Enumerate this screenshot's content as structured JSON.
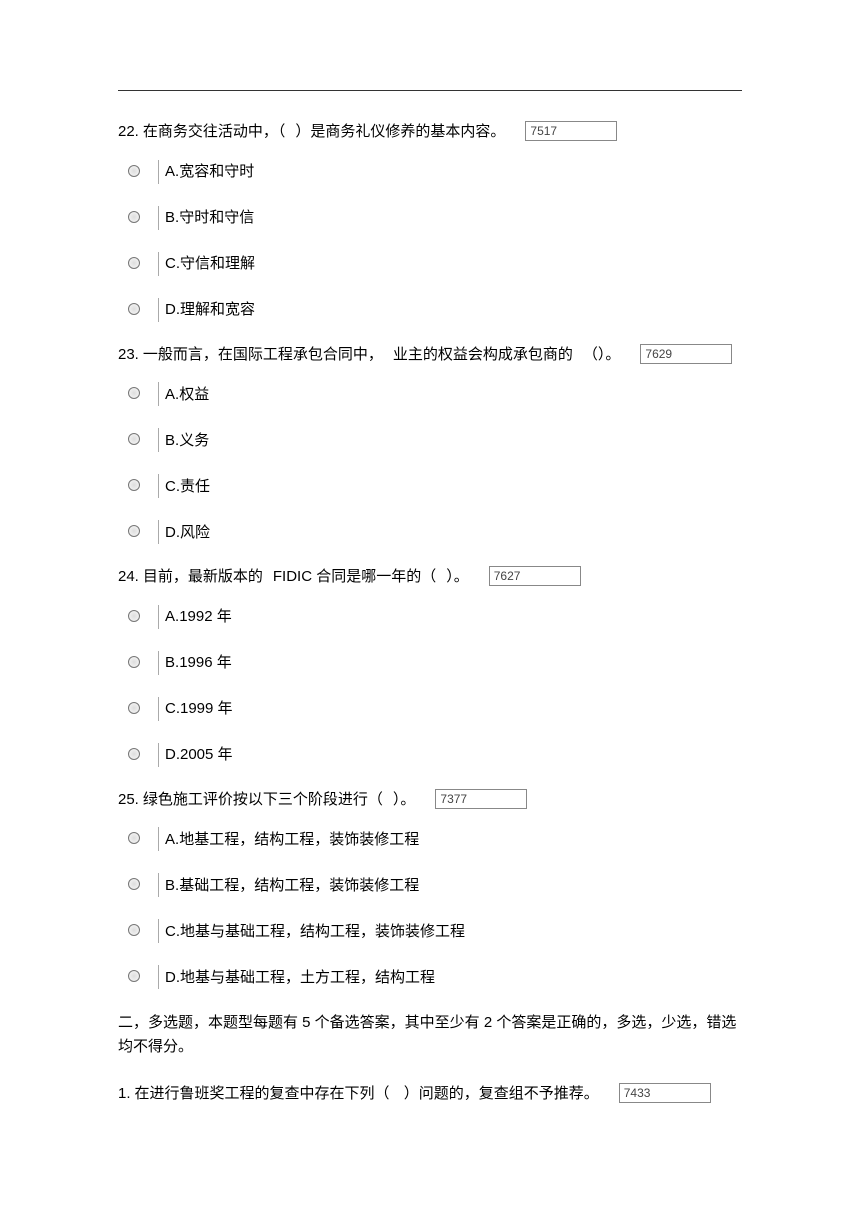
{
  "questions": [
    {
      "num": "22.",
      "parts": [
        "在商务交往活动中，（",
        "）是商务礼仪修养的基本内容。"
      ],
      "code": "7517",
      "options": [
        {
          "label": "A.",
          "text": "宽容和守时"
        },
        {
          "label": "B.",
          "text": "守时和守信"
        },
        {
          "label": "C.",
          "text": "守信和理解"
        },
        {
          "label": "D.",
          "text": "理解和宽容"
        }
      ]
    },
    {
      "num": "23.",
      "parts": [
        "一般而言，在国际工程承包合同中，",
        "业主的权益会构成承包商的",
        "（）。"
      ],
      "code": "7629",
      "options": [
        {
          "label": "A.",
          "text": "权益"
        },
        {
          "label": "B.",
          "text": "义务"
        },
        {
          "label": "C.",
          "text": "责任"
        },
        {
          "label": "D.",
          "text": "风险"
        }
      ]
    },
    {
      "num": "24.",
      "parts": [
        "目前，最新版本的",
        "FIDIC 合同是哪一年的（",
        "）。"
      ],
      "code": "7627",
      "options": [
        {
          "label": "A.",
          "text": "1992 年"
        },
        {
          "label": "B.",
          "text": "1996 年"
        },
        {
          "label": "C.",
          "text": "1999 年"
        },
        {
          "label": "D.",
          "text": "2005 年"
        }
      ]
    },
    {
      "num": "25.",
      "parts": [
        "绿色施工评价按以下三个阶段进行（",
        "）。"
      ],
      "code": "7377",
      "options": [
        {
          "label": "A.",
          "text": "地基工程，结构工程，装饰装修工程"
        },
        {
          "label": "B.",
          "text": "基础工程，结构工程，装饰装修工程"
        },
        {
          "label": "C.",
          "text": "地基与基础工程，结构工程，装饰装修工程"
        },
        {
          "label": "D.",
          "text": "地基与基础工程，土方工程，结构工程"
        }
      ]
    }
  ],
  "section2_note": "二，多选题，本题型每题有 5 个备选答案，其中至少有 2 个答案是正确的，多选，少选，错选均不得分。",
  "section2_q1": {
    "num": "1.",
    "parts": [
      "在进行鲁班奖工程的复查中存在下列（",
      "）问题的，复查组不予推荐。"
    ],
    "code": "7433"
  }
}
